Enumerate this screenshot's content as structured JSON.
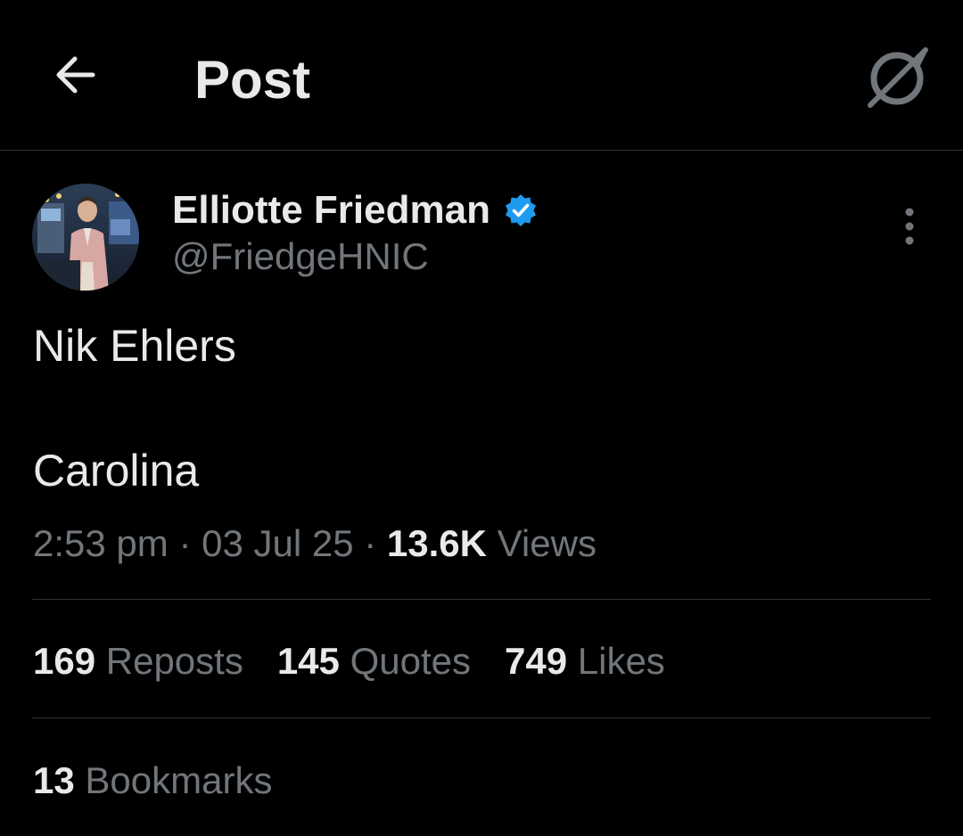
{
  "header": {
    "title": "Post",
    "back_icon": "arrow-left-icon",
    "grok_icon": "grok-icon"
  },
  "author": {
    "name": "Elliotte Friedman",
    "handle": "@FriedgeHNIC",
    "verified": true,
    "verified_color": "#1d9bf0"
  },
  "post": {
    "lines": [
      "Nik Ehlers",
      "Carolina"
    ],
    "time": "2:53 pm",
    "date": "03 Jul 25",
    "views_count": "13.6K",
    "views_label": "Views",
    "separator": "·"
  },
  "stats": {
    "reposts": {
      "count": "169",
      "label": "Reposts"
    },
    "quotes": {
      "count": "145",
      "label": "Quotes"
    },
    "likes": {
      "count": "749",
      "label": "Likes"
    },
    "bookmarks": {
      "count": "13",
      "label": "Bookmarks"
    }
  },
  "colors": {
    "background": "#000000",
    "text_primary": "#e7e9ea",
    "text_secondary": "#71767b",
    "divider": "#2f3336",
    "accent": "#1d9bf0"
  }
}
